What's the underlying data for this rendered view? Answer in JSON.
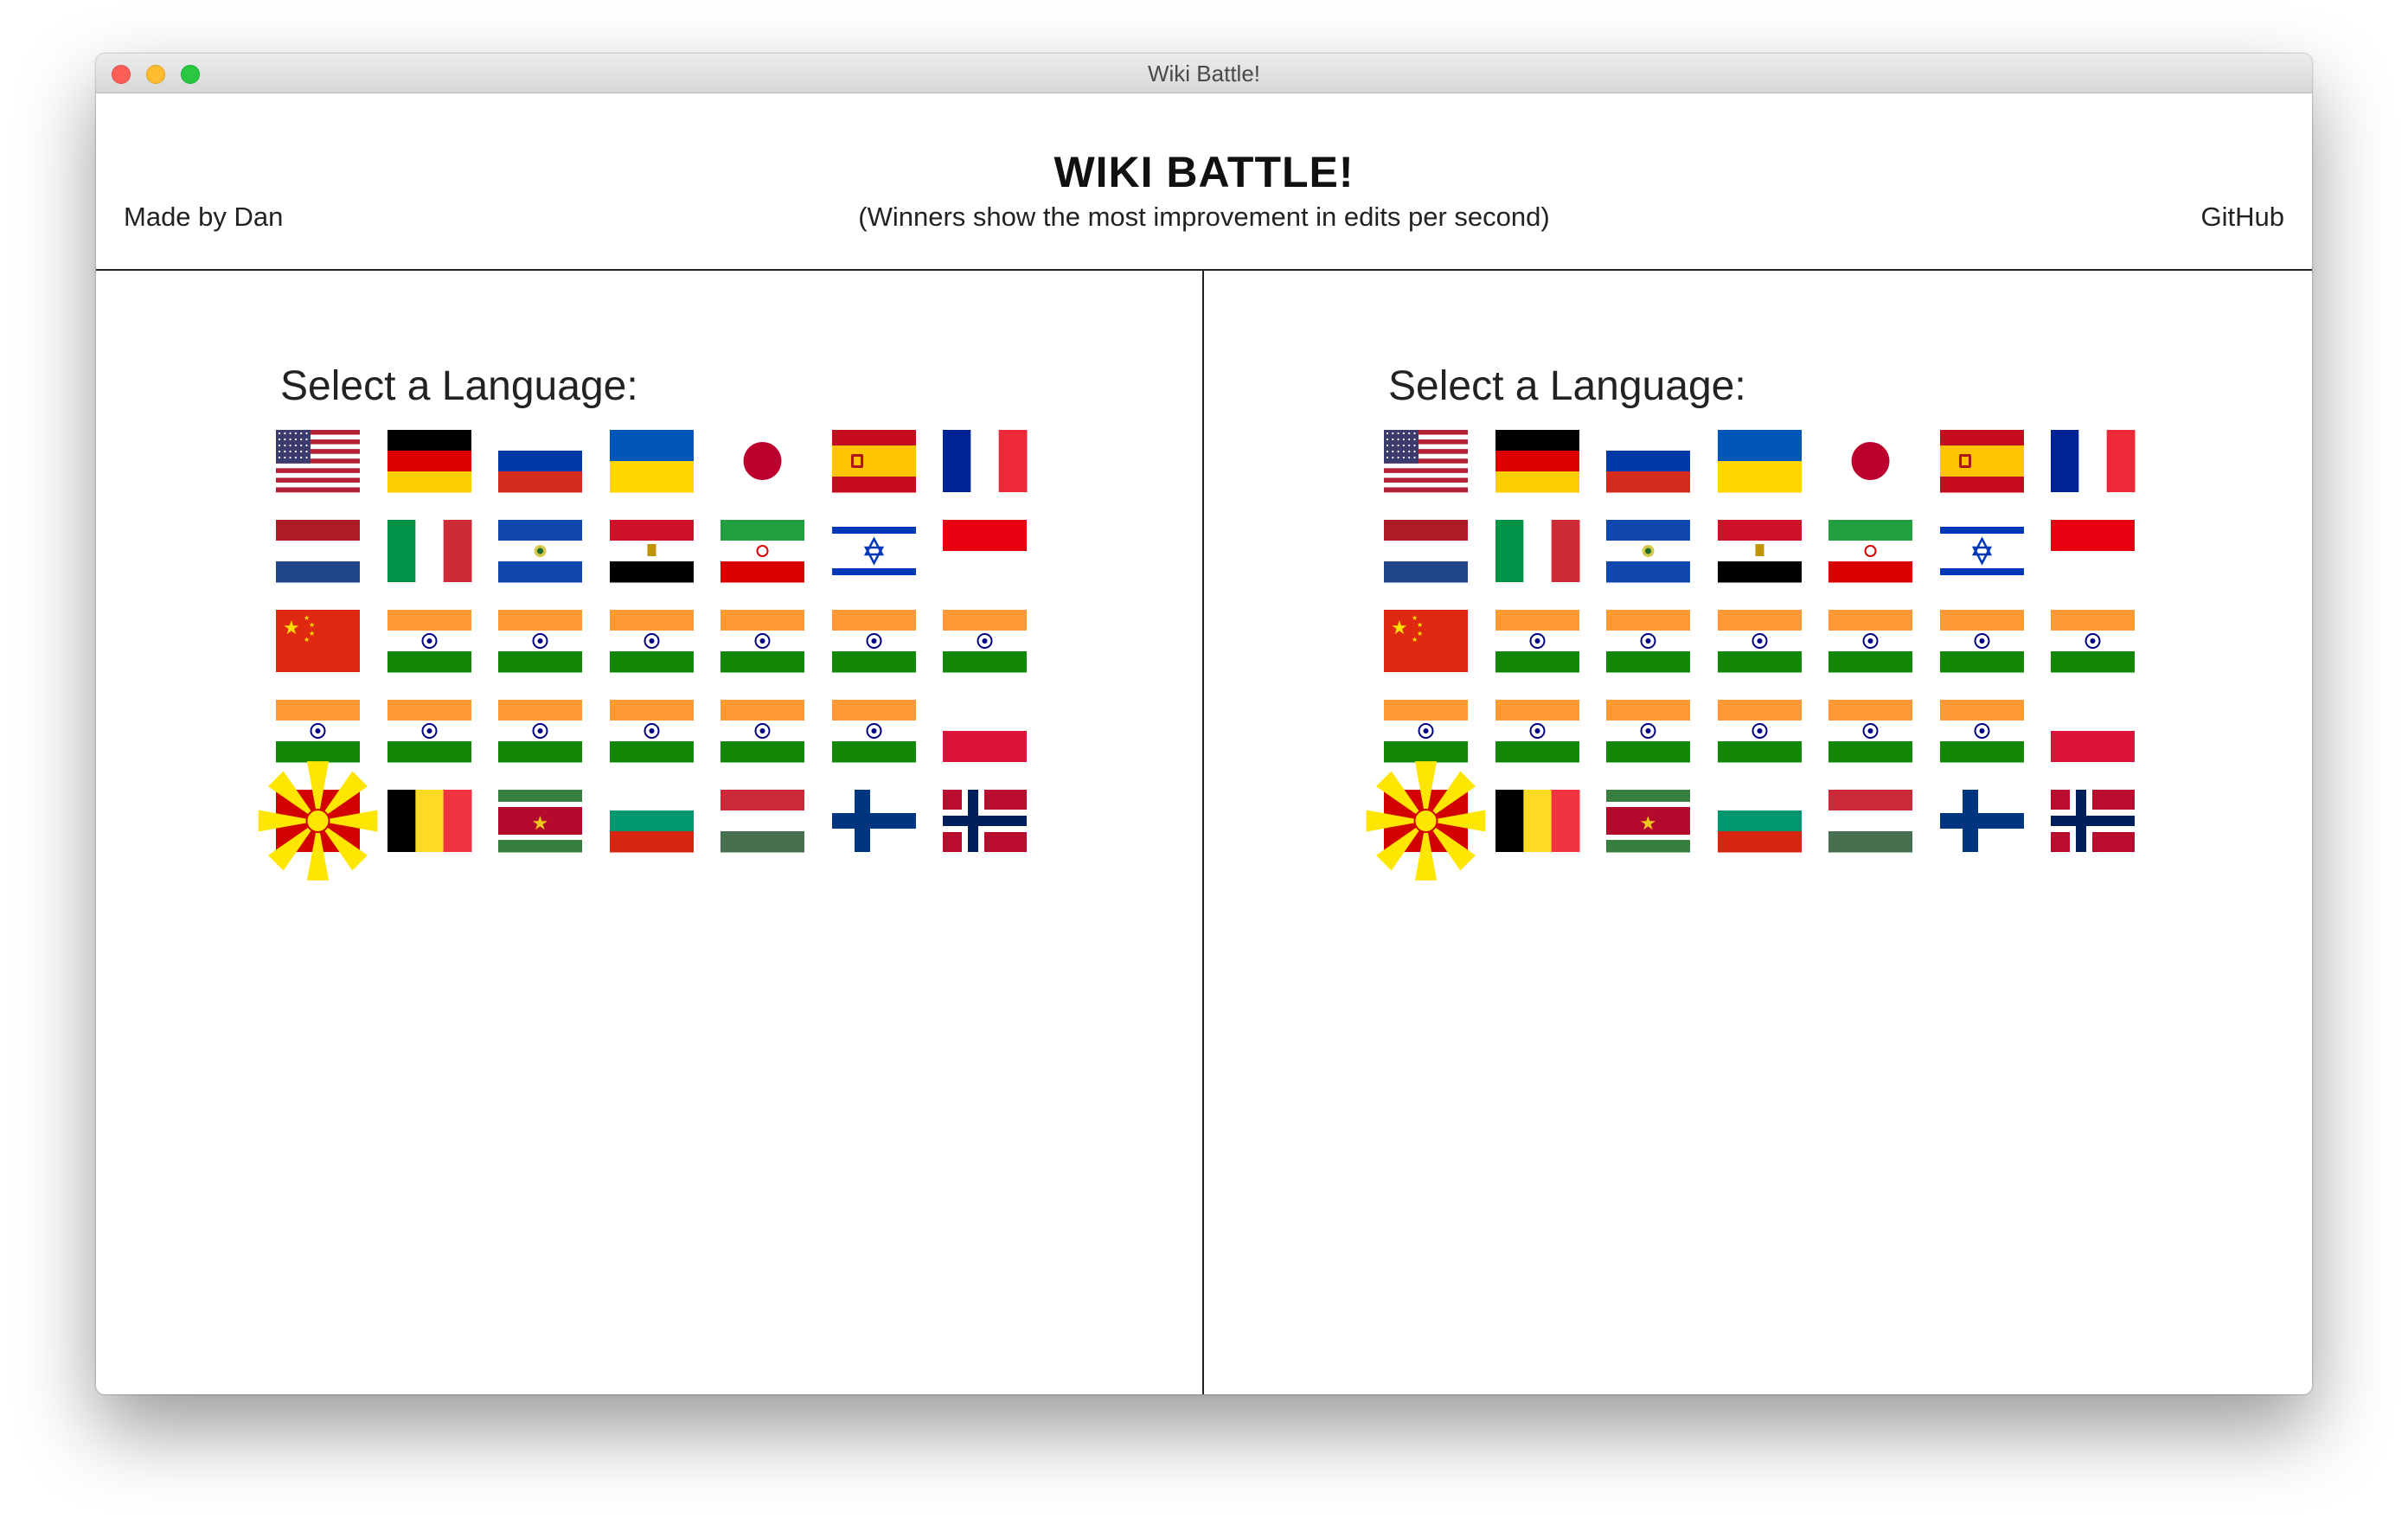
{
  "window": {
    "title": "Wiki Battle!"
  },
  "header": {
    "title": "WIKI BATTLE!",
    "subtitle": "(Winners show the most improvement in edits per second)",
    "made_by": "Made by Dan",
    "github": "GitHub"
  },
  "panels": [
    {
      "label": "Select a Language:"
    },
    {
      "label": "Select a Language:"
    }
  ],
  "flags": [
    "us-flag",
    "germany-flag",
    "russia-flag",
    "ukraine-flag",
    "japan-flag",
    "spain-flag",
    "france-flag",
    "netherlands-flag",
    "italy-flag",
    "el-salvador-flag",
    "egypt-flag",
    "iran-flag",
    "israel-flag",
    "indonesia-flag",
    "china-flag",
    "india-flag",
    "india-flag",
    "india-flag",
    "india-flag",
    "india-flag",
    "india-flag",
    "india-flag",
    "india-flag",
    "india-flag",
    "india-flag",
    "india-flag",
    "india-flag",
    "poland-flag",
    "macedonia-flag",
    "belgium-flag",
    "suriname-flag",
    "bulgaria-flag",
    "hungary-flag",
    "finland-flag",
    "norway-flag"
  ],
  "colors": {
    "india_saffron": "#ff9933",
    "india_green": "#138808",
    "red": "#e0001b",
    "blue": "#0038a8"
  }
}
